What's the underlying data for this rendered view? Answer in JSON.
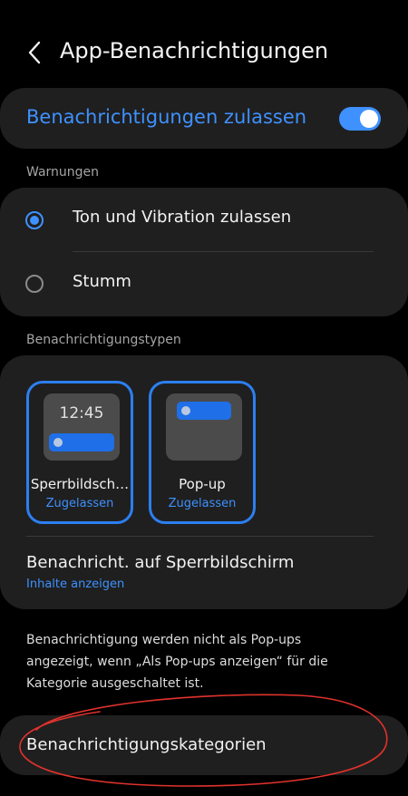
{
  "header": {
    "title": "App-Benachrichtigungen"
  },
  "master": {
    "label": "Benachrichtigungen zulassen",
    "enabled": true
  },
  "warnings": {
    "section_label": "Warnungen",
    "options": [
      {
        "label": "Ton und Vibration zulassen",
        "selected": true
      },
      {
        "label": "Stumm",
        "selected": false
      }
    ]
  },
  "types": {
    "section_label": "Benachrichtigungstypen",
    "tiles": [
      {
        "name": "Sperrbildsch…",
        "status": "Zugelassen",
        "preview_time": "12:45"
      },
      {
        "name": "Pop-up",
        "status": "Zugelassen"
      }
    ],
    "lockscreen": {
      "title": "Benachricht. auf Sperrbildschirm",
      "subtitle": "Inhalte anzeigen"
    }
  },
  "info": {
    "text": "Benachrichtigung werden nicht als Pop-ups angezeigt, wenn „Als Pop-ups anzeigen“ für die Kategorie ausgeschaltet ist."
  },
  "categories": {
    "label": "Benachrichtigungskategorien"
  },
  "colors": {
    "accent": "#3e91ff",
    "card": "#1f1f1f",
    "background": "#000000",
    "annotation": "#e0322c"
  },
  "icons": {
    "back": "chevron-left-icon",
    "toggle": "toggle-switch-icon"
  }
}
